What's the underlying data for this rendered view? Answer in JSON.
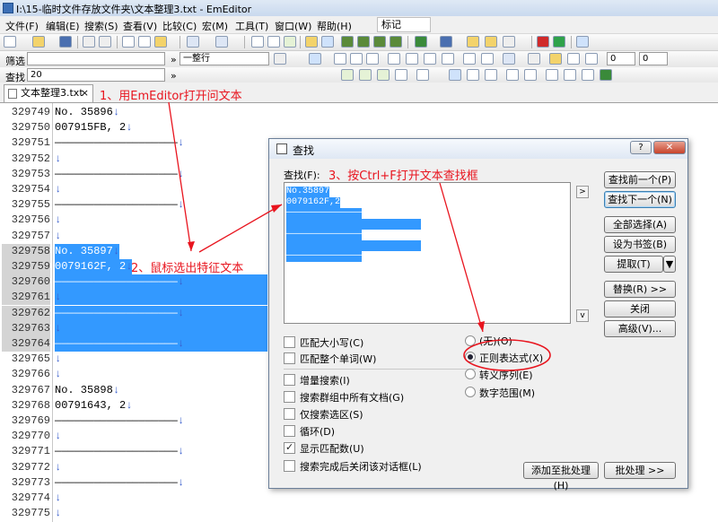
{
  "window": {
    "title": "I:\\15-临时文件存放文件夹\\文本整理3.txt - EmEditor"
  },
  "menu": {
    "items": [
      "文件(F)",
      "编辑(E)",
      "搜索(S)",
      "查看(V)",
      "比较(C)",
      "宏(M)",
      "工具(T)",
      "窗口(W)",
      "帮助(H)"
    ],
    "marker": "标记"
  },
  "filter_bar": {
    "label": "筛选",
    "mode": "一整行",
    "options": [
      "0",
      "0"
    ]
  },
  "find_bar": {
    "label": "查找",
    "value": "20"
  },
  "tab": {
    "name": "文本整理3.txt",
    "close": "×"
  },
  "editor": {
    "lines": [
      {
        "n": "329749",
        "text": "No. 35896"
      },
      {
        "n": "329750",
        "text": "007915FB, 2"
      },
      {
        "n": "329751",
        "text": "———————————————————"
      },
      {
        "n": "329752",
        "text": ""
      },
      {
        "n": "329753",
        "text": "———————————————————"
      },
      {
        "n": "329754",
        "text": ""
      },
      {
        "n": "329755",
        "text": "———————————————————"
      },
      {
        "n": "329756",
        "text": ""
      },
      {
        "n": "329757",
        "text": ""
      },
      {
        "n": "329758",
        "text": "No. 35897"
      },
      {
        "n": "329759",
        "text": "0079162F, 2"
      },
      {
        "n": "329760",
        "text": "———————————————————"
      },
      {
        "n": "329761",
        "text": ""
      },
      {
        "n": "329762",
        "text": "———————————————————"
      },
      {
        "n": "329763",
        "text": ""
      },
      {
        "n": "329764",
        "text": "———————————————————"
      },
      {
        "n": "329765",
        "text": ""
      },
      {
        "n": "329766",
        "text": ""
      },
      {
        "n": "329767",
        "text": "No. 35898"
      },
      {
        "n": "329768",
        "text": "00791643, 2"
      },
      {
        "n": "329769",
        "text": "———————————————————"
      },
      {
        "n": "329770",
        "text": ""
      },
      {
        "n": "329771",
        "text": "———————————————————"
      },
      {
        "n": "329772",
        "text": ""
      },
      {
        "n": "329773",
        "text": "———————————————————"
      },
      {
        "n": "329774",
        "text": ""
      },
      {
        "n": "329775",
        "text": ""
      }
    ]
  },
  "dialog": {
    "title": "查找",
    "help": "?",
    "close": "✕",
    "find_label": "查找(F):",
    "find_lines": [
      "No.35897",
      "0079162F,2",
      "——————————————",
      "",
      "——————————————",
      "",
      "——————————————"
    ],
    "expand": ">",
    "scroll_down": "v",
    "buttons": {
      "find_prev": "查找前一个(P)",
      "find_next": "查找下一个(N)",
      "select_all": "全部选择(A)",
      "bookmark": "设为书签(B)",
      "extract": "提取(T)",
      "replace": "替换(R) >>",
      "close": "关闭",
      "advanced": "高级(V)...",
      "add_batch": "添加至批处理(H)",
      "batch": "批处理 >>"
    },
    "options": {
      "match_case": "匹配大小写(C)",
      "whole_word": "匹配整个单词(W)",
      "incremental": "增量搜索(I)",
      "all_docs": "搜索群组中所有文档(G)",
      "selection_only": "仅搜索选区(S)",
      "loop": "循环(D)",
      "show_count": "显示匹配数(U)",
      "close_after": "搜索完成后关闭该对话框(L)"
    },
    "radios": {
      "none": "(无)(O)",
      "regex": "正则表达式(X)",
      "escape": "转义序列(E)",
      "numeric": "数字范围(M)"
    }
  },
  "annotations": {
    "step1": "1、用EmEditor打开问文本",
    "step2": "2、鼠标选出特征文本",
    "step3": "3、按Ctrl+F打开文本查找框"
  },
  "colors": {
    "selection": "#3399ff",
    "annotation": "#e8141e"
  }
}
